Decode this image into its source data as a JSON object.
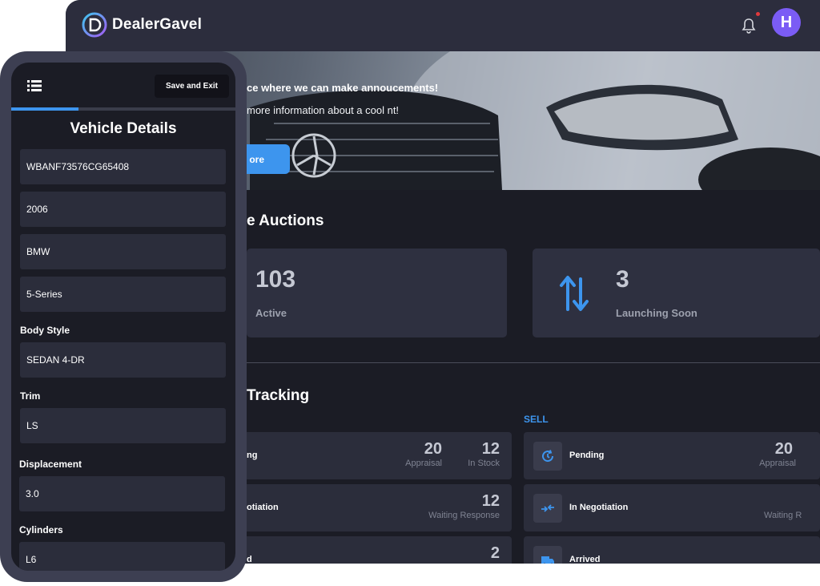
{
  "brand": {
    "name": "DealerGavel",
    "accent": "#3d95ee",
    "avatar_color": "#7b5cf5"
  },
  "topbar": {
    "avatar_initial": "H",
    "notification_icon": "bell-icon"
  },
  "hero": {
    "title": "ce where we can make annoucements!",
    "subtitle": "more information about a cool nt!",
    "button_label": "ore"
  },
  "auctions": {
    "title": "e Auctions",
    "cards": [
      {
        "value": "103",
        "label": "Active"
      },
      {
        "value": "3",
        "label": "Launching Soon",
        "icon": "swap-arrows-icon"
      }
    ]
  },
  "tracking": {
    "title": "Tracking",
    "sell_label": "SELL",
    "buy_rows": [
      {
        "name": "ng",
        "stats": [
          {
            "value": "20",
            "label": "Appraisal"
          },
          {
            "value": "12",
            "label": "In Stock"
          }
        ]
      },
      {
        "name": "otiation",
        "stats": [
          {
            "value": "12",
            "label": "Waiting Response"
          }
        ]
      },
      {
        "name": "d",
        "stats": [
          {
            "value": "2",
            "label": ""
          }
        ]
      }
    ],
    "sell_rows": [
      {
        "name": "Pending",
        "icon": "pending-icon",
        "stats": [
          {
            "value": "20",
            "label": "Appraisal"
          }
        ]
      },
      {
        "name": "In Negotiation",
        "icon": "negotiation-icon",
        "stats": [
          {
            "value": "",
            "label": "Waiting R"
          }
        ]
      },
      {
        "name": "Arrived",
        "icon": "truck-icon",
        "stats": []
      }
    ]
  },
  "phone": {
    "save_label": "Save and Exit",
    "menu_icon": "list-icon",
    "progress": 0.3,
    "title": "Vehicle Details",
    "fields": {
      "vin": "WBANF73576CG65408",
      "year": "2006",
      "make": "BMW",
      "model": "5-Series",
      "body_style_label": "Body Style",
      "body_style": "SEDAN 4-DR",
      "trim_label": "Trim",
      "trim": "LS",
      "displacement_label": "Displacement",
      "displacement": "3.0",
      "cylinders_label": "Cylinders",
      "cylinders": "L6"
    }
  }
}
